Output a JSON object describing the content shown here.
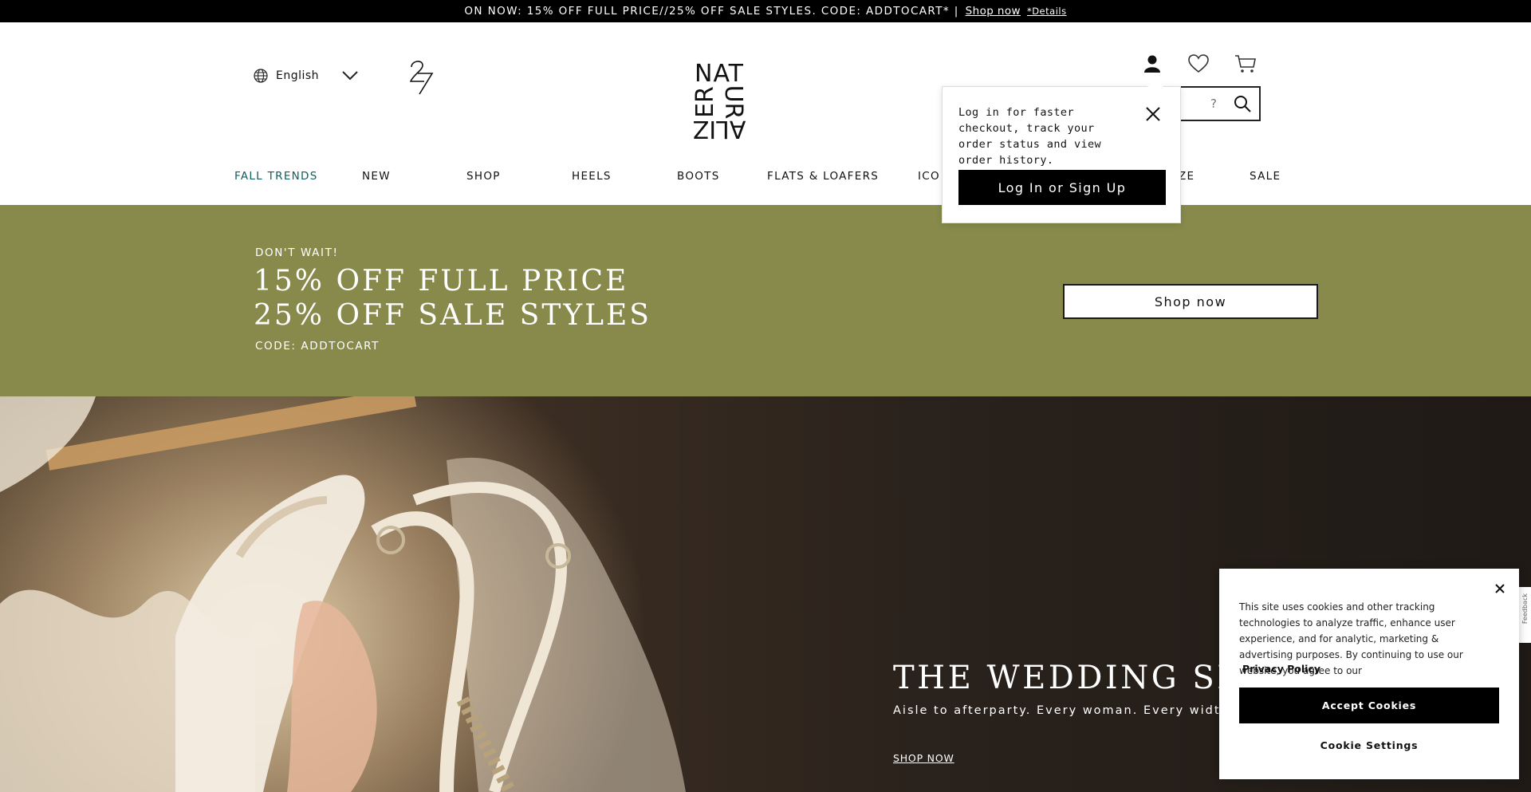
{
  "promo": {
    "text": "ON NOW: 15% OFF FULL PRICE//25% OFF SALE STYLES. CODE: ADDTOCART* |",
    "link": "Shop now",
    "details": "*Details"
  },
  "header": {
    "language": "English",
    "logo27": "27",
    "logo_text": "NATURALIZER",
    "search_placeholder": "?"
  },
  "nav": {
    "items": [
      {
        "label": "FALL TRENDS",
        "active": true
      },
      {
        "label": "NEW"
      },
      {
        "label": "SHOP"
      },
      {
        "label": "HEELS"
      },
      {
        "label": "BOOTS"
      },
      {
        "label": "FLATS & LOAFERS"
      },
      {
        "label": "ICO"
      },
      {
        "label": "ZE"
      },
      {
        "label": "SALE"
      }
    ]
  },
  "login_popup": {
    "text": "Log in for faster checkout, track your order status and view order history.",
    "button": "Log In or Sign Up"
  },
  "banner": {
    "kicker": "DON'T WAIT!",
    "line1": "15% OFF FULL PRICE",
    "line2": "25% OFF SALE STYLES",
    "code": "CODE: ADDTOCART",
    "button": "Shop now",
    "bg_color": "#878a4b"
  },
  "hero": {
    "title": "THE WEDDING SHOP",
    "subtitle": "Aisle to afterparty. Every woman. Every width. Every w",
    "link": "SHOP NOW"
  },
  "cookie": {
    "text": "This site uses cookies and other tracking technologies to analyze traffic, enhance user experience, and for analytic, marketing & advertising purposes. By continuing to use our website, you agree to our",
    "privacy": "Privacy Policy",
    "accept": "Accept Cookies",
    "settings": "Cookie Settings"
  },
  "feedback": {
    "label": "Feedback"
  }
}
